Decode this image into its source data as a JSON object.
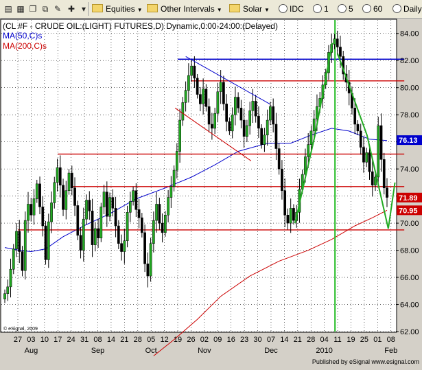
{
  "toolbar": {
    "menus": [
      {
        "label": "Equities",
        "icon": "folder-icon"
      },
      {
        "label": "Other Intervals",
        "icon": "folder-icon"
      },
      {
        "label": "Solar",
        "icon": "folder-icon"
      }
    ],
    "intervals": [
      "IDC",
      "1",
      "5",
      "60",
      "Daily"
    ]
  },
  "chart_data": {
    "type": "candlestick",
    "title": "(CL #F - CRUDE OIL:(LIGHT) FUTURES,D) Dynamic,0:00-24:00:(Delayed)",
    "indicators": [
      {
        "name": "MA(50,C)s",
        "color": "#0000cc"
      },
      {
        "name": "MA(200,C)s",
        "color": "#cc0000"
      }
    ],
    "ylim": [
      62,
      85
    ],
    "y_ticks": [
      "62.00",
      "64.00",
      "66.00",
      "68.00",
      "70.00",
      "72.00",
      "74.00",
      "76.00",
      "78.00",
      "80.00",
      "82.00",
      "84.00"
    ],
    "x_day_labels": [
      "27",
      "03",
      "10",
      "17",
      "24",
      "31",
      "08",
      "14",
      "21",
      "28",
      "05",
      "12",
      "19",
      "26",
      "02",
      "09",
      "16",
      "23",
      "30",
      "07",
      "14",
      "21",
      "28",
      "04",
      "11",
      "19",
      "25",
      "01",
      "08"
    ],
    "x_month_labels": [
      {
        "label": "Aug",
        "index": 1
      },
      {
        "label": "Sep",
        "index": 6
      },
      {
        "label": "Oct",
        "index": 10
      },
      {
        "label": "Nov",
        "index": 14
      },
      {
        "label": "Dec",
        "index": 19
      },
      {
        "label": "2010",
        "index": 23
      },
      {
        "label": "Feb",
        "index": 28
      }
    ],
    "price_markers": [
      {
        "value": 76.13,
        "label": "76.13",
        "color": "#0000cc"
      },
      {
        "value": 71.89,
        "label": "71.89",
        "color": "#cc0000"
      },
      {
        "value": 70.95,
        "label": "70.95",
        "color": "#cc0000"
      }
    ],
    "horizontal_lines": [
      {
        "value": 82.1,
        "color": "#0000cc",
        "from": 12,
        "to": 29
      },
      {
        "value": 80.5,
        "color": "#cc0000",
        "from": 13,
        "to": 29
      },
      {
        "value": 75.1,
        "color": "#cc0000",
        "from": 3,
        "to": 29
      },
      {
        "value": 72.7,
        "color": "#cc0000",
        "from": 4,
        "to": 29
      },
      {
        "value": 69.5,
        "color": "#cc0000",
        "from": 0,
        "to": 29
      }
    ],
    "trend_lines": [
      {
        "from": [
          12.6,
          82.3
        ],
        "to": [
          18.9,
          78.8
        ],
        "color": "#0000cc"
      },
      {
        "from": [
          11.8,
          78.5
        ],
        "to": [
          17.5,
          74.6
        ],
        "color": "#cc0000"
      },
      {
        "from": [
          20.8,
          70.0
        ],
        "to": [
          22.3,
          76.5
        ],
        "color": "#22aa22"
      },
      {
        "from": [
          22.3,
          76.5
        ],
        "to": [
          23.6,
          83.3
        ],
        "color": "#22aa22"
      },
      {
        "from": [
          24.0,
          82.5
        ],
        "to": [
          26.2,
          76.5
        ],
        "color": "#22aa22"
      },
      {
        "from": [
          26.2,
          76.5
        ],
        "to": [
          27.8,
          69.6
        ],
        "color": "#22aa22"
      },
      {
        "from": [
          27.8,
          69.6
        ],
        "to": [
          28.3,
          73.0
        ],
        "color": "#22aa22"
      }
    ],
    "vertical_line": {
      "x": 23.8,
      "color": "#22bb22"
    },
    "closes": [
      64.8,
      65.3,
      66.6,
      68.1,
      69.4,
      67.9,
      66.5,
      70.2,
      71.4,
      70.6,
      71.8,
      72.9,
      71.2,
      69.8,
      67.3,
      70.1,
      71.5,
      73.0,
      74.1,
      72.8,
      71.0,
      72.4,
      73.7,
      72.6,
      71.3,
      69.1,
      68.0,
      70.3,
      71.7,
      70.9,
      68.4,
      69.6,
      68.9,
      71.2,
      72.3,
      70.5,
      71.9,
      71.1,
      69.8,
      68.5,
      67.9,
      68.7,
      70.8,
      71.6,
      72.4,
      71.0,
      70.4,
      69.3,
      67.0,
      66.1,
      68.5,
      70.2,
      71.4,
      70.0,
      69.3,
      70.6,
      71.9,
      72.7,
      73.9,
      75.3,
      77.6,
      78.9,
      79.8,
      80.9,
      81.6,
      80.7,
      79.5,
      78.8,
      79.9,
      78.6,
      77.3,
      77.0,
      78.1,
      79.7,
      80.4,
      78.8,
      77.5,
      76.8,
      78.0,
      79.3,
      78.5,
      77.6,
      76.4,
      77.2,
      78.3,
      79.0,
      77.9,
      77.0,
      75.8,
      76.5,
      77.6,
      78.6,
      77.3,
      75.5,
      74.0,
      72.4,
      70.6,
      70.0,
      71.1,
      70.2,
      70.8,
      72.5,
      73.6,
      74.9,
      75.8,
      76.8,
      77.7,
      78.6,
      79.2,
      80.2,
      81.1,
      82.6,
      83.2,
      83.6,
      83.0,
      82.3,
      81.0,
      80.4,
      79.6,
      78.5,
      77.3,
      76.8,
      75.6,
      74.5,
      75.2,
      73.8,
      72.8,
      73.4,
      77.2,
      74.7,
      72.6,
      71.9
    ],
    "ma50": [
      [
        0,
        68.2
      ],
      [
        5,
        68.0
      ],
      [
        9,
        67.9
      ],
      [
        14,
        68.1
      ],
      [
        20,
        69.0
      ],
      [
        28,
        69.9
      ],
      [
        36,
        70.7
      ],
      [
        45,
        71.8
      ],
      [
        55,
        72.6
      ],
      [
        64,
        73.4
      ],
      [
        72,
        74.3
      ],
      [
        80,
        75.3
      ],
      [
        90,
        75.9
      ],
      [
        98,
        75.9
      ],
      [
        105,
        76.5
      ],
      [
        112,
        77.0
      ],
      [
        118,
        76.8
      ],
      [
        125,
        76.2
      ],
      [
        131,
        76.1
      ]
    ],
    "ma200": [
      [
        51,
        60.2
      ],
      [
        58,
        61.4
      ],
      [
        66,
        62.9
      ],
      [
        74,
        64.6
      ],
      [
        84,
        66.1
      ],
      [
        94,
        67.2
      ],
      [
        104,
        68.0
      ],
      [
        112,
        68.8
      ],
      [
        120,
        69.8
      ],
      [
        126,
        70.4
      ],
      [
        131,
        70.95
      ]
    ],
    "watermark": "© eSignal, 2009",
    "footer": "Published by eSignal www.esignal.com"
  }
}
